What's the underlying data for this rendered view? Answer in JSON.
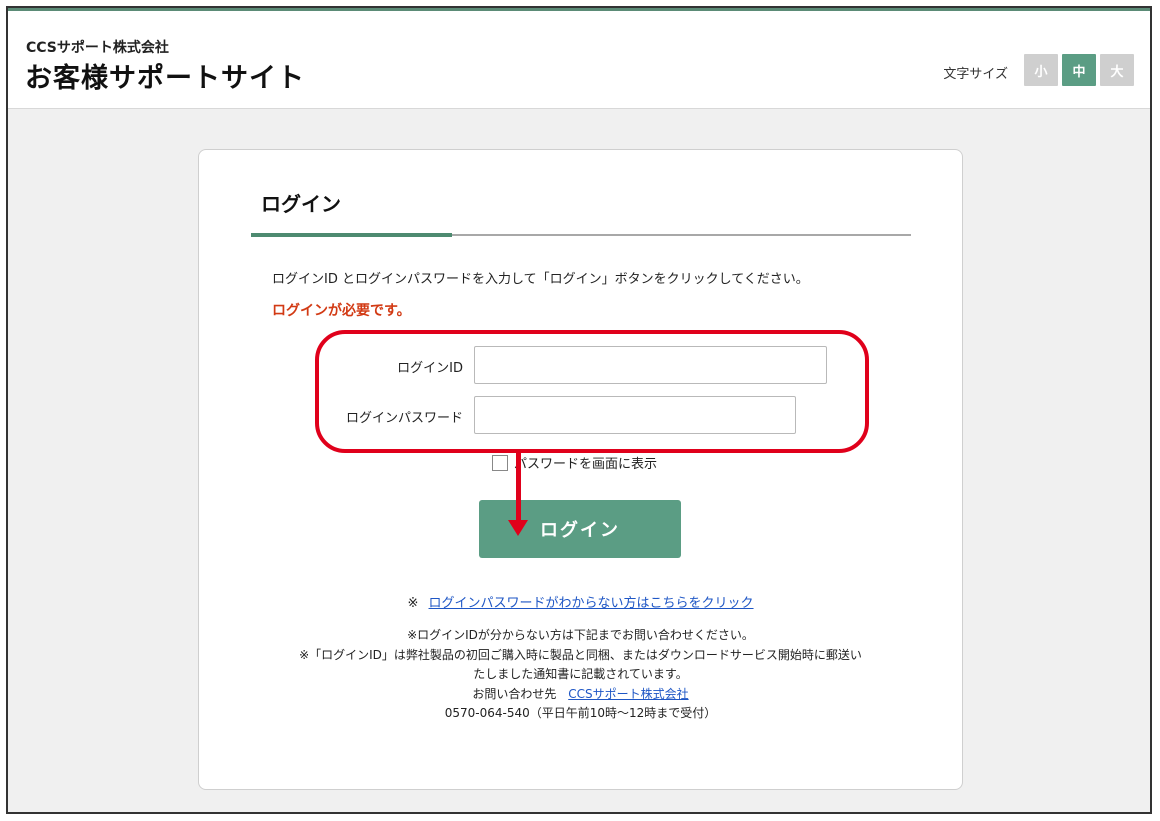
{
  "header": {
    "company": "CCSサポート株式会社",
    "site_title": "お客様サポートサイト",
    "font_size_label": "文字サイズ",
    "font_sizes": [
      {
        "label": "小",
        "active": false
      },
      {
        "label": "中",
        "active": true
      },
      {
        "label": "大",
        "active": false
      }
    ]
  },
  "login": {
    "title": "ログイン",
    "instruction": "ログインID とログインパスワードを入力して「ログイン」ボタンをクリックしてください。",
    "required_message": "ログインが必要です。",
    "id_label": "ログインID",
    "id_value": "",
    "password_label": "ログインパスワード",
    "password_value": "",
    "show_password_label": "パスワードを画面に表示",
    "show_password_checked": false,
    "submit_label": "ログイン",
    "forgot_prefix": "※",
    "forgot_link": "ログインパスワードがわからない方はこちらをクリック",
    "notes": {
      "line1": "※ログインIDが分からない方は下記までお問い合わせください。",
      "line2": "※「ログインID」は弊社製品の初回ご購入時に製品と同梱、またはダウンロードサービス開始時に郵送い",
      "line3": "たしました通知書に記載されています。",
      "contact_label": "お問い合わせ先",
      "contact_link": "CCSサポート株式会社",
      "phone": "0570-064-540（平日午前10時〜12時まで受付）"
    }
  },
  "colors": {
    "accent": "#5b9d84",
    "error": "#d23a14",
    "annotation": "#e0001b",
    "link": "#1e56c5"
  }
}
